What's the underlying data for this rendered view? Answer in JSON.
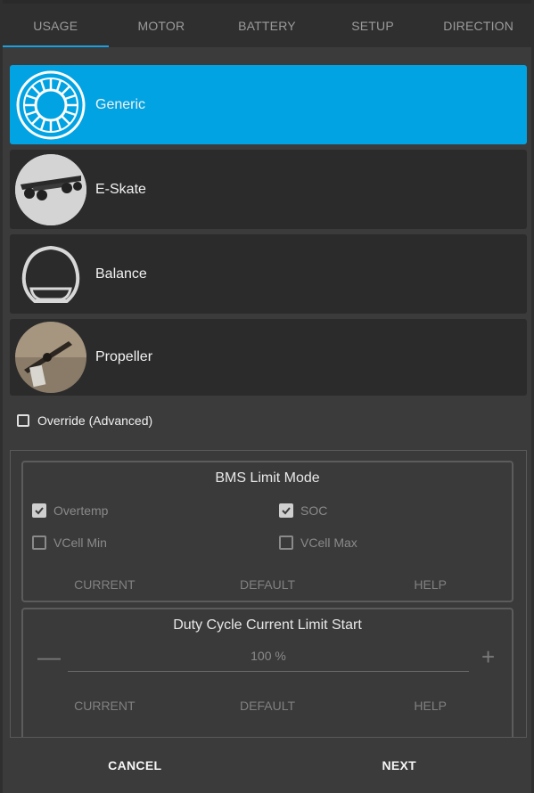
{
  "tabs": [
    {
      "label": "USAGE",
      "active": true
    },
    {
      "label": "MOTOR",
      "active": false
    },
    {
      "label": "BATTERY",
      "active": false
    },
    {
      "label": "SETUP",
      "active": false
    },
    {
      "label": "DIRECTION",
      "active": false
    }
  ],
  "usage_options": [
    {
      "label": "Generic",
      "icon": "wheel-icon",
      "selected": true
    },
    {
      "label": "E-Skate",
      "icon": "eskate-photo",
      "selected": false
    },
    {
      "label": "Balance",
      "icon": "balance-wheel-icon",
      "selected": false
    },
    {
      "label": "Propeller",
      "icon": "propeller-photo",
      "selected": false
    }
  ],
  "override": {
    "label": "Override (Advanced)",
    "checked": false
  },
  "bms_group": {
    "title": "BMS Limit Mode",
    "options": [
      {
        "label": "Overtemp",
        "checked": true
      },
      {
        "label": "SOC",
        "checked": true
      },
      {
        "label": "VCell Min",
        "checked": false
      },
      {
        "label": "VCell Max",
        "checked": false
      }
    ],
    "buttons": [
      "CURRENT",
      "DEFAULT",
      "HELP"
    ]
  },
  "duty_group": {
    "title": "Duty Cycle Current Limit Start",
    "value": "100 %",
    "minus": "—",
    "plus": "+",
    "buttons": [
      "CURRENT",
      "DEFAULT",
      "HELP"
    ]
  },
  "footer": {
    "cancel": "CANCEL",
    "next": "NEXT"
  },
  "colors": {
    "accent": "#02a3e3",
    "tab_indicator": "#1a9fe0",
    "card": "#2b2b2b",
    "background": "#3b3b3b"
  }
}
